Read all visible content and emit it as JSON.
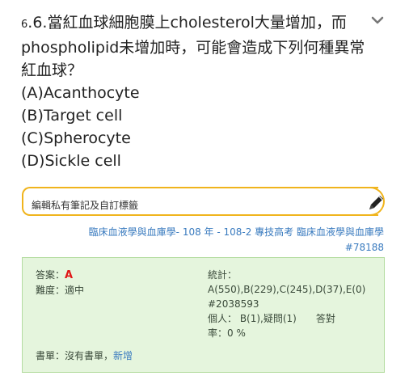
{
  "question": {
    "prefix_small": "6",
    "line1": ".6.當紅血球細胞膜上cholesterol大量增加，而",
    "line2": "phospholipid未增加時，可能會造成下列何種異常",
    "line3": "紅血球？",
    "options": [
      "(A)Acanthocyte",
      "(B)Target cell",
      "(C)Spherocyte",
      "(D)Sickle cell"
    ]
  },
  "note": {
    "placeholder": "編輯私有筆記及自訂標籤"
  },
  "source": {
    "subject": "臨床血液學與血庫學",
    "exam": "- 108 年 - 108-2 專技高考 臨床血液學與血庫學",
    "id": "#78188"
  },
  "panel": {
    "answer_label": "答案：",
    "answer_value": "A",
    "difficulty_label": "難度：",
    "difficulty_value": "適中",
    "stats_label": "統計：",
    "stats_value": "A(550),B(229),C(245),D(37),E(0)",
    "stats_id": "#2038593",
    "personal_line1": "個人： B(1),疑問(1)　　答對",
    "personal_line2": "率：0 %",
    "booklist_label": "書單：",
    "booklist_value": "沒有書單",
    "booklist_sep": "，",
    "booklist_add": "新增"
  },
  "colors": {
    "note_border": "#f0b41c",
    "link": "#3a7bbf",
    "answer": "#e01818",
    "panel_bg": "#e5f5dd"
  },
  "icons": [
    "chevron-down-icon",
    "pencil-icon"
  ]
}
